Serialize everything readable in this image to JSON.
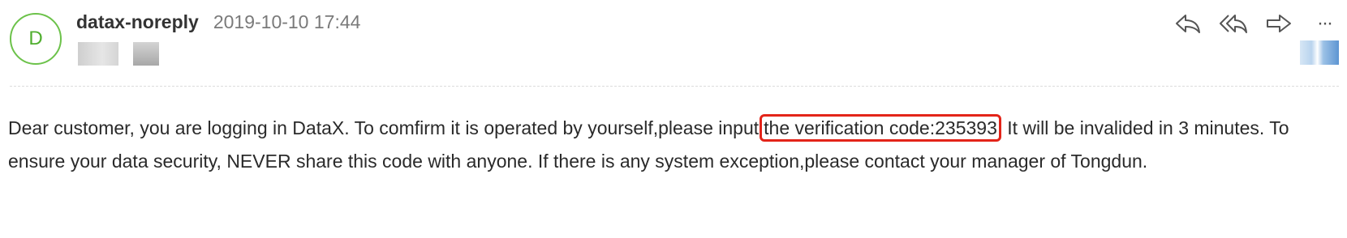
{
  "header": {
    "avatar_letter": "D",
    "sender": "datax-noreply",
    "datetime": "2019-10-10 17:44"
  },
  "toolbar": {
    "reply_icon": "reply-icon",
    "reply_all_icon": "reply-all-icon",
    "forward_icon": "forward-icon",
    "more_label": "···"
  },
  "body": {
    "text_before": "Dear customer, you are logging in DataX. To comfirm it is operated by yourself,please input",
    "highlight": "the verification code:235393",
    "text_after": " It will be invalided in 3 minutes. To ensure your data security, NEVER share this code with anyone. If there is any system exception,please contact your manager of Tongdun."
  },
  "colors": {
    "avatar_ring": "#6cc24a",
    "highlight_border": "#e32419"
  }
}
